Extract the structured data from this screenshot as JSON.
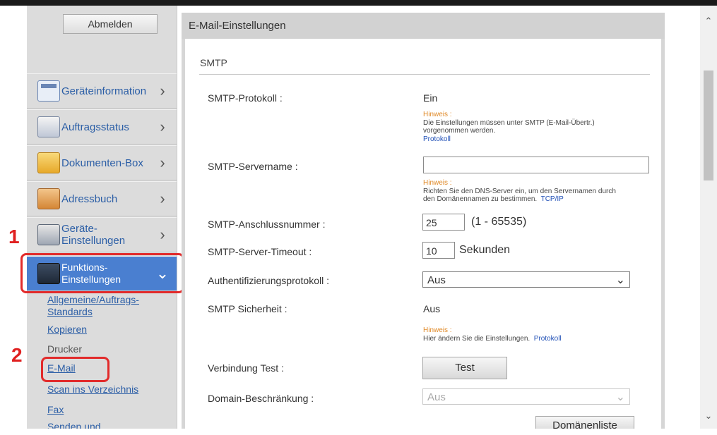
{
  "sidebar": {
    "logout_label": "Abmelden",
    "items": [
      {
        "label": "Geräteinformation",
        "icon": "device-info-icon"
      },
      {
        "label": "Auftragsstatus",
        "icon": "job-status-icon"
      },
      {
        "label": "Dokumenten-Box",
        "icon": "document-box-icon"
      },
      {
        "label": "Adressbuch",
        "icon": "address-book-icon"
      },
      {
        "label": "Geräte-\nEinstellungen",
        "icon": "device-settings-icon"
      },
      {
        "label": "Funktions-\nEinstellungen",
        "icon": "function-settings-icon",
        "active": true
      }
    ],
    "subitems": [
      {
        "label": "Allgemeine/Auftrags-\nStandards"
      },
      {
        "label": "Kopieren"
      },
      {
        "label": "Drucker"
      },
      {
        "label": "E-Mail"
      },
      {
        "label": "Scan ins Verzeichnis"
      },
      {
        "label": "Fax"
      },
      {
        "label": "Senden und"
      }
    ]
  },
  "annotations": {
    "step1": "1",
    "step2": "2"
  },
  "panel": {
    "title": "E-Mail-Einstellungen",
    "section": "SMTP",
    "rows": {
      "protocol": {
        "label": "SMTP-Protokoll :",
        "value": "Ein"
      },
      "servername": {
        "label": "SMTP-Servername :",
        "value": ""
      },
      "port": {
        "label": "SMTP-Anschlussnummer :",
        "value": "25",
        "range": "(1 - 65535)"
      },
      "timeout": {
        "label": "SMTP-Server-Timeout :",
        "value": "10",
        "unit": "Sekunden"
      },
      "auth": {
        "label": "Authentifizierungsprotokoll :",
        "value": "Aus"
      },
      "security": {
        "label": "SMTP Sicherheit :",
        "value": "Aus"
      },
      "conn_test": {
        "label": "Verbindung Test :",
        "button": "Test"
      },
      "domain": {
        "label": "Domain-Beschränkung :",
        "value": "Aus"
      }
    },
    "hints": {
      "h1": {
        "title": "Hinweis :",
        "line1": "Die Einstellungen müssen unter SMTP (E-Mail-Übertr.)",
        "line2": "vorgenommen werden.",
        "link": "Protokoll"
      },
      "h2": {
        "title": "Hinweis :",
        "line1": "Richten Sie den DNS-Server ein, um den Servernamen durch",
        "line2": "den Domänennamen zu bestimmen.",
        "link": "TCP/IP"
      },
      "h3": {
        "title": "Hinweis :",
        "line1": "Hier ändern Sie die Einstellungen.",
        "link": "Protokoll"
      }
    },
    "domain_list_button": "Domänenliste"
  },
  "colors": {
    "accent": "#4a7fd0",
    "highlight": "#e22b2b",
    "hint": "#e08a28",
    "link": "#1f4fb6"
  }
}
